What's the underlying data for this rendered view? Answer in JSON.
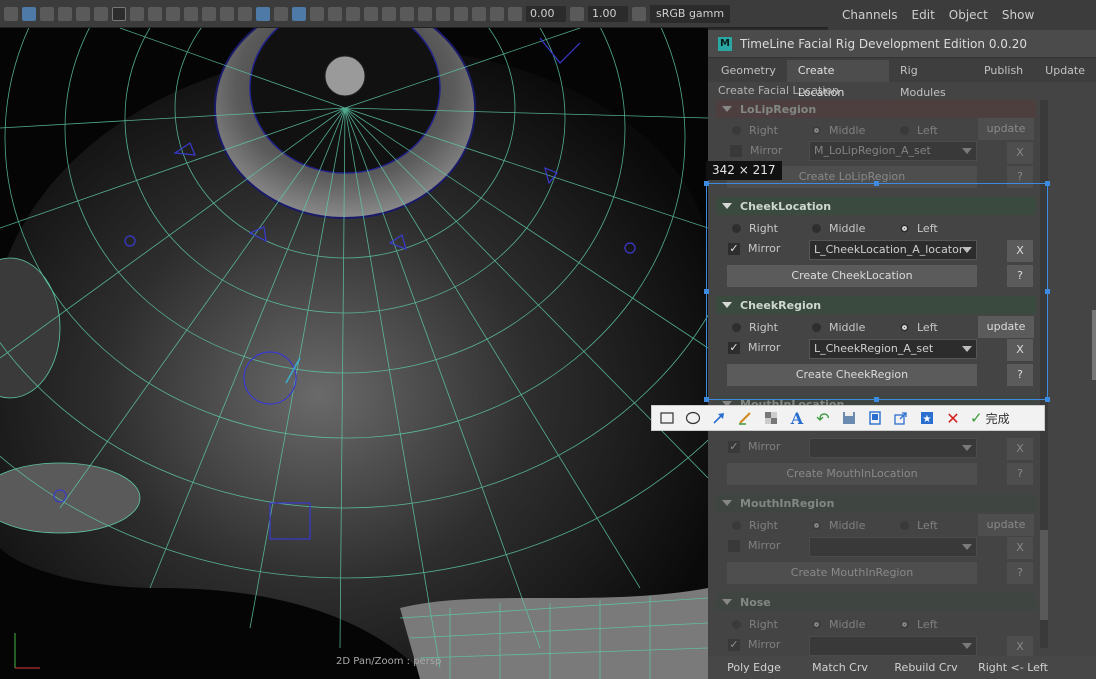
{
  "toolbar": {
    "exposure_value": "0.00",
    "gamma_value": "1.00",
    "color_space": "sRGB gamm"
  },
  "channel_box": {
    "menus": [
      "Channels",
      "Edit",
      "Object",
      "Show"
    ]
  },
  "viewport": {
    "status": "2D Pan/Zoom : persp"
  },
  "tool_window": {
    "title": "TimeLine Facial Rig Development Edition 0.0.20",
    "logo": "M",
    "tabs": [
      "Geometry",
      "Create Location",
      "Rig Modules",
      "Publish",
      "Update"
    ],
    "active_tab": "Create Location",
    "group_title": "Create Facial Location",
    "sections": {
      "lolipregion": {
        "name": "LoLipRegion",
        "right": "Right",
        "middle": "Middle",
        "left": "Left",
        "update": "update",
        "mirror": "Mirror",
        "dropdown": "M_LoLipRegion_A_set",
        "create": "Create  LoLipRegion",
        "x": "X",
        "help": "?"
      },
      "cheeklocation": {
        "name": "CheekLocation",
        "right": "Right",
        "middle": "Middle",
        "left": "Left",
        "mirror": "Mirror",
        "dropdown": "L_CheekLocation_A_locator",
        "create": "Create  CheekLocation",
        "x": "X",
        "help": "?"
      },
      "cheekregion": {
        "name": "CheekRegion",
        "right": "Right",
        "middle": "Middle",
        "left": "Left",
        "update": "update",
        "mirror": "Mirror",
        "dropdown": "L_CheekRegion_A_set",
        "create": "Create  CheekRegion",
        "x": "X",
        "help": "?"
      },
      "mouthinlocation": {
        "name": "MouthInLocation",
        "mirror": "Mirror",
        "create": "Create  MouthInLocation",
        "x": "X",
        "help": "?"
      },
      "mouthinregion": {
        "name": "MouthInRegion",
        "right": "Right",
        "middle": "Middle",
        "left": "Left",
        "update": "update",
        "mirror": "Mirror",
        "create": "Create  MouthInRegion",
        "x": "X",
        "help": "?"
      },
      "nose": {
        "name": "Nose",
        "right": "Right",
        "middle": "Middle",
        "left": "Left",
        "mirror": "Mirror",
        "x": "X"
      }
    },
    "bottom_buttons": [
      "Poly Edge",
      "Match Crv",
      "Rebuild Crv",
      "Right <- Left"
    ]
  },
  "snip": {
    "size": "342 × 217",
    "done": "完成"
  },
  "colors": {
    "selection": "#3d8be0",
    "section_header": "#3a4a3f",
    "wire": "#5ec8a8"
  }
}
